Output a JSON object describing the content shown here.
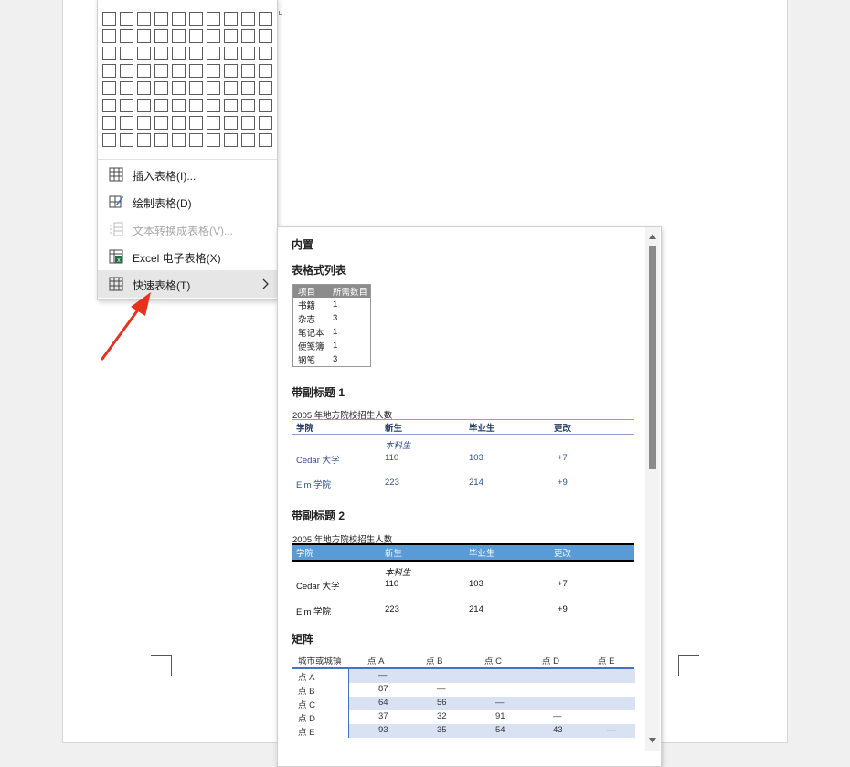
{
  "menu": {
    "items": [
      {
        "label": "插入表格(I)...",
        "icon": "insert-table-icon",
        "enabled": true
      },
      {
        "label": "绘制表格(D)",
        "icon": "draw-table-icon",
        "enabled": true
      },
      {
        "label": "文本转换成表格(V)...",
        "icon": "convert-text-icon",
        "enabled": false
      },
      {
        "label": "Excel 电子表格(X)",
        "icon": "excel-icon",
        "enabled": true
      },
      {
        "label": "快速表格(T)",
        "icon": "quick-table-icon",
        "enabled": true,
        "submenu": true
      }
    ]
  },
  "gallery": {
    "heading": "内置",
    "sections": {
      "tabular": {
        "title": "表格式列表",
        "header": [
          "项目",
          "所需数目"
        ],
        "rows": [
          [
            "书籍",
            "1"
          ],
          [
            "杂志",
            "3"
          ],
          [
            "笔记本",
            "1"
          ],
          [
            "便笺簿",
            "1"
          ],
          [
            "钢笔",
            "3"
          ]
        ]
      },
      "sub1": {
        "title": "带副标题 1",
        "caption": "2005 年地方院校招生人数",
        "header": [
          "学院",
          "新生",
          "毕业生",
          "更改"
        ],
        "subheading": "本科生",
        "rows": [
          [
            "Cedar 大学",
            "110",
            "103",
            "+7"
          ],
          [
            "Elm 学院",
            "223",
            "214",
            "+9"
          ]
        ]
      },
      "sub2": {
        "title": "带副标题 2",
        "caption": "2005 年地方院校招生人数",
        "header": [
          "学院",
          "新生",
          "毕业生",
          "更改"
        ],
        "subheading": "本科生",
        "rows": [
          [
            "Cedar 大学",
            "110",
            "103",
            "+7"
          ],
          [
            "Elm 学院",
            "223",
            "214",
            "+9"
          ]
        ]
      },
      "matrix": {
        "title": "矩阵",
        "header": [
          "城市或城镇",
          "点 A",
          "点 B",
          "点 C",
          "点 D",
          "点 E"
        ],
        "rows": [
          [
            "点 A",
            "—",
            "",
            "",
            "",
            ""
          ],
          [
            "点 B",
            "87",
            "—",
            "",
            "",
            ""
          ],
          [
            "点 C",
            "64",
            "56",
            "—",
            "",
            ""
          ],
          [
            "点 D",
            "37",
            "32",
            "91",
            "—",
            ""
          ],
          [
            "点 E",
            "93",
            "35",
            "54",
            "43",
            "—"
          ]
        ]
      }
    }
  },
  "colors": {
    "accent_blue": "#5b9bd5",
    "matrix_band": "#d9e2f3",
    "arrow_red": "#e8321e"
  }
}
